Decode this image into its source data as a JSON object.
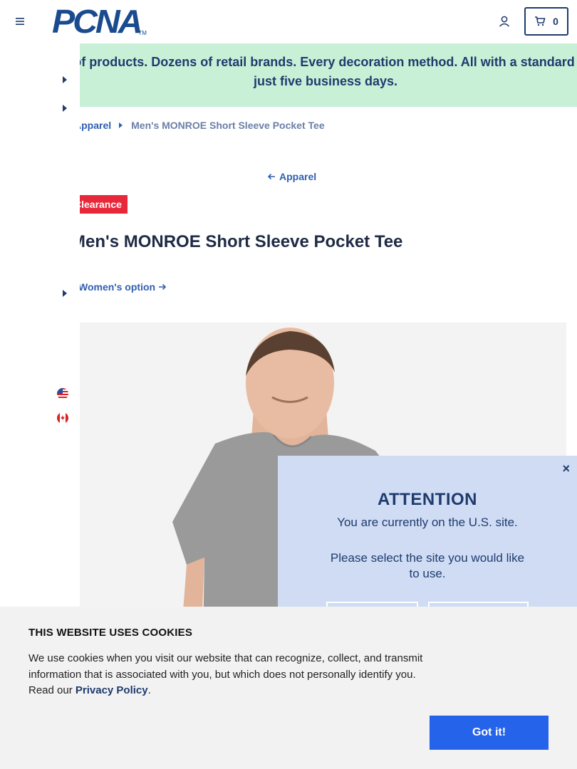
{
  "header": {
    "logo_text": "PCNA",
    "logo_tm": "TM",
    "cart_count": "0"
  },
  "promo": {
    "text": "Thousands of products. Dozens of retail brands. Every decoration method. All with a standard lead time of just five business days."
  },
  "breadcrumb": {
    "parent": "Apparel",
    "current": "Men's MONROE Short Sleeve Pocket Tee"
  },
  "back_link": "Apparel",
  "badge": "Clearance",
  "product": {
    "title": "Men's MONROE Short Sleeve Pocket Tee",
    "option_link": "Women's option"
  },
  "attention": {
    "title": "ATTENTION",
    "line1": "You are currently on the U.S. site.",
    "line2": "Please select the site you would like to use.",
    "close": "×"
  },
  "cookie": {
    "title": "THIS WEBSITE USES COOKIES",
    "text_before": "We use cookies when you visit our website that can recognize, collect, and transmit information that is associated with you, but which does not personally identify you. Read our ",
    "link": "Privacy Policy",
    "text_after": ".",
    "button": "Got it!"
  },
  "colors": {
    "brand_navy": "#1f3b6e",
    "promo_bg": "#c8f0d6",
    "badge_red": "#e8283a",
    "modal_bg": "#cfdcf4",
    "cookie_button": "#2563eb"
  },
  "icons": [
    "menu-icon",
    "account-icon",
    "cart-icon",
    "caret-right-icon",
    "arrow-left-icon",
    "arrow-right-icon",
    "us-flag-icon",
    "canada-flag-icon",
    "close-icon"
  ]
}
